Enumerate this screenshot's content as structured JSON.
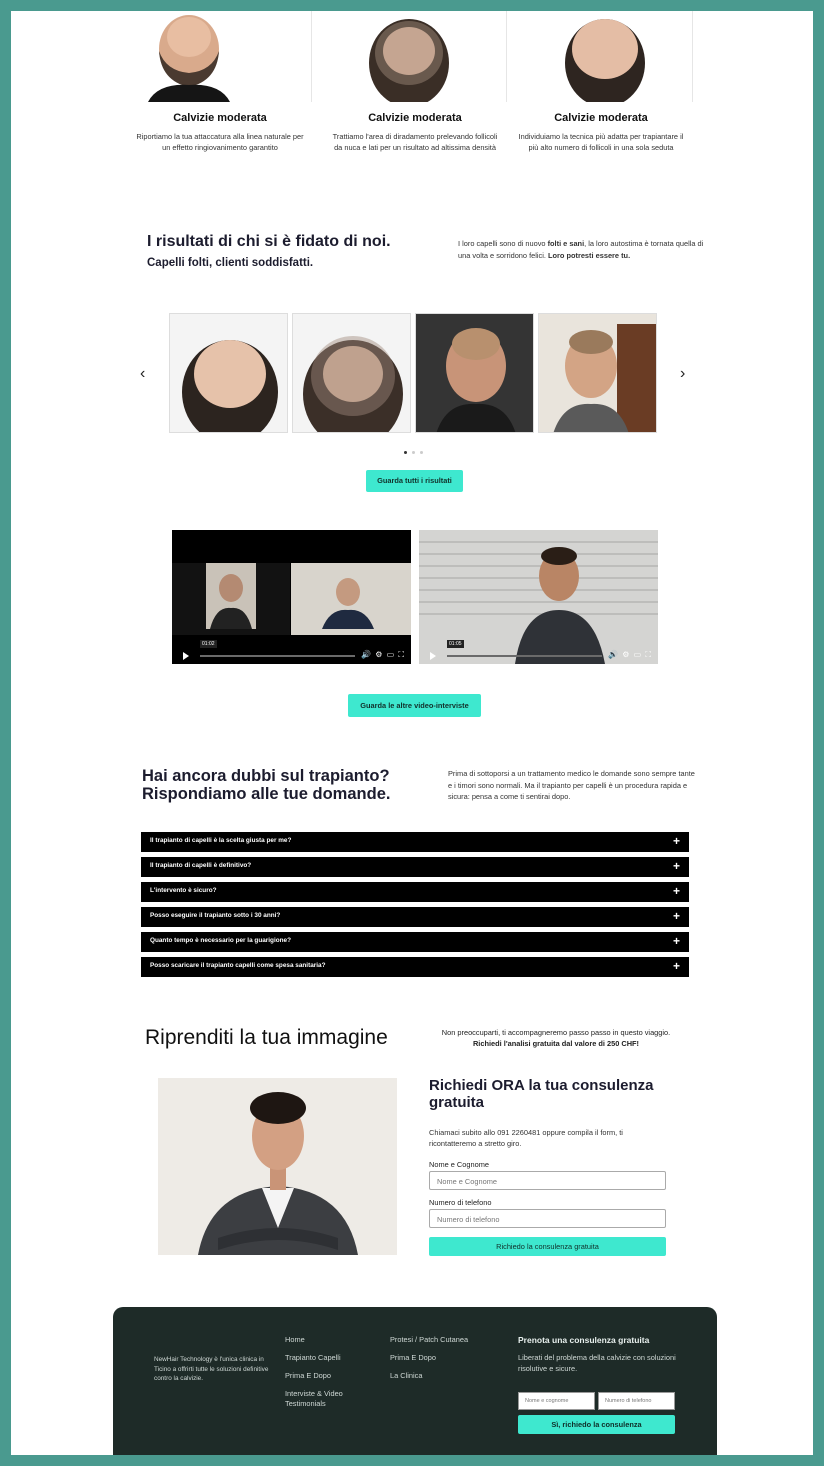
{
  "cards": [
    {
      "title": "Calvizie moderata",
      "text": "Riportiamo la tua attaccatura alla linea naturale per un effetto ringiovanimento garantito"
    },
    {
      "title": "Calvizie moderata",
      "text": "Trattiamo l'area di diradamento prelevando follicoli da nuca e lati per un risultato ad altissima densità"
    },
    {
      "title": "Calvizie moderata",
      "text": "Individuiamo la tecnica più adatta per trapiantare il più alto numero di follicoli in una sola seduta"
    }
  ],
  "results": {
    "title": "I risultati di chi si è fidato di noi.",
    "subtitle": "Capelli folti, clienti soddisfatti.",
    "desc_a": "I loro capelli sono di nuovo ",
    "desc_b": "folti e sani",
    "desc_c": ", la loro autostima è tornata quella di una volta e sorridono felici. ",
    "desc_d": "Loro potresti essere tu.",
    "prev": "‹",
    "next": "›",
    "button": "Guarda tutti i risultati"
  },
  "videos": {
    "v1_time": "01:02",
    "v2_time": "01:05",
    "controls": "🔊 ⚙ ▭ ⛶",
    "button": "Guarda le altre video-interviste"
  },
  "faq": {
    "title": "Hai ancora dubbi sul trapianto? Rispondiamo alle tue domande.",
    "desc": "Prima di sottoporsi a un trattamento medico le domande sono sempre tante e i timori sono normali. Ma il trapianto per capelli è un procedura rapida e sicura: pensa a come ti sentirai dopo.",
    "items": [
      "Il trapianto di capelli è la scelta giusta per me?",
      "Il trapianto di capelli è definitivo?",
      "L'intervento è sicuro?",
      "Posso eseguire il trapianto sotto i 30 anni?",
      "Quanto tempo è necessario per la guarigione?",
      "Posso scaricare il trapianto capelli come spesa sanitaria?"
    ],
    "plus": "+"
  },
  "consult": {
    "title": "Riprenditi la tua immagine",
    "desc_a": "Non preoccuparti, ti accompagneremo passo passo in questo viaggio. ",
    "desc_b": "Richiedi l'analisi gratuita dal valore di 250 CHF!",
    "form_title": "Richiedi ORA la tua consulenza gratuita",
    "form_desc": "Chiamaci subito allo 091 2260481 oppure compila il form, ti ricontatteremo a stretto giro.",
    "name_label": "Nome e Cognome",
    "name_placeholder": "Nome e Cognome",
    "phone_label": "Numero di telefono",
    "phone_placeholder": "Numero di telefono",
    "submit": "Richiedo la consulenza gratuita"
  },
  "footer": {
    "about": "NewHair Technology è l'unica clinica in Ticino a offrirti tutte le soluzioni definitive contro la calvizie.",
    "col1": [
      "Home",
      "Trapianto Capelli",
      "Prima E Dopo",
      "Interviste & Video Testimonials"
    ],
    "col2": [
      "Protesi / Patch Cutanea",
      "Prima E Dopo",
      "La Clinica"
    ],
    "title": "Prenota una consulenza gratuita",
    "desc": "Liberati del problema della calvizie con soluzioni risolutive e sicure.",
    "name_placeholder": "Nome e cognome",
    "phone_placeholder": "Numero di telefono",
    "button": "Sì, richiedo la consulenza"
  },
  "colors": {
    "accent": "#3ee8cf",
    "frame": "#4a9a8f",
    "footer_bg": "#1e2b28"
  }
}
